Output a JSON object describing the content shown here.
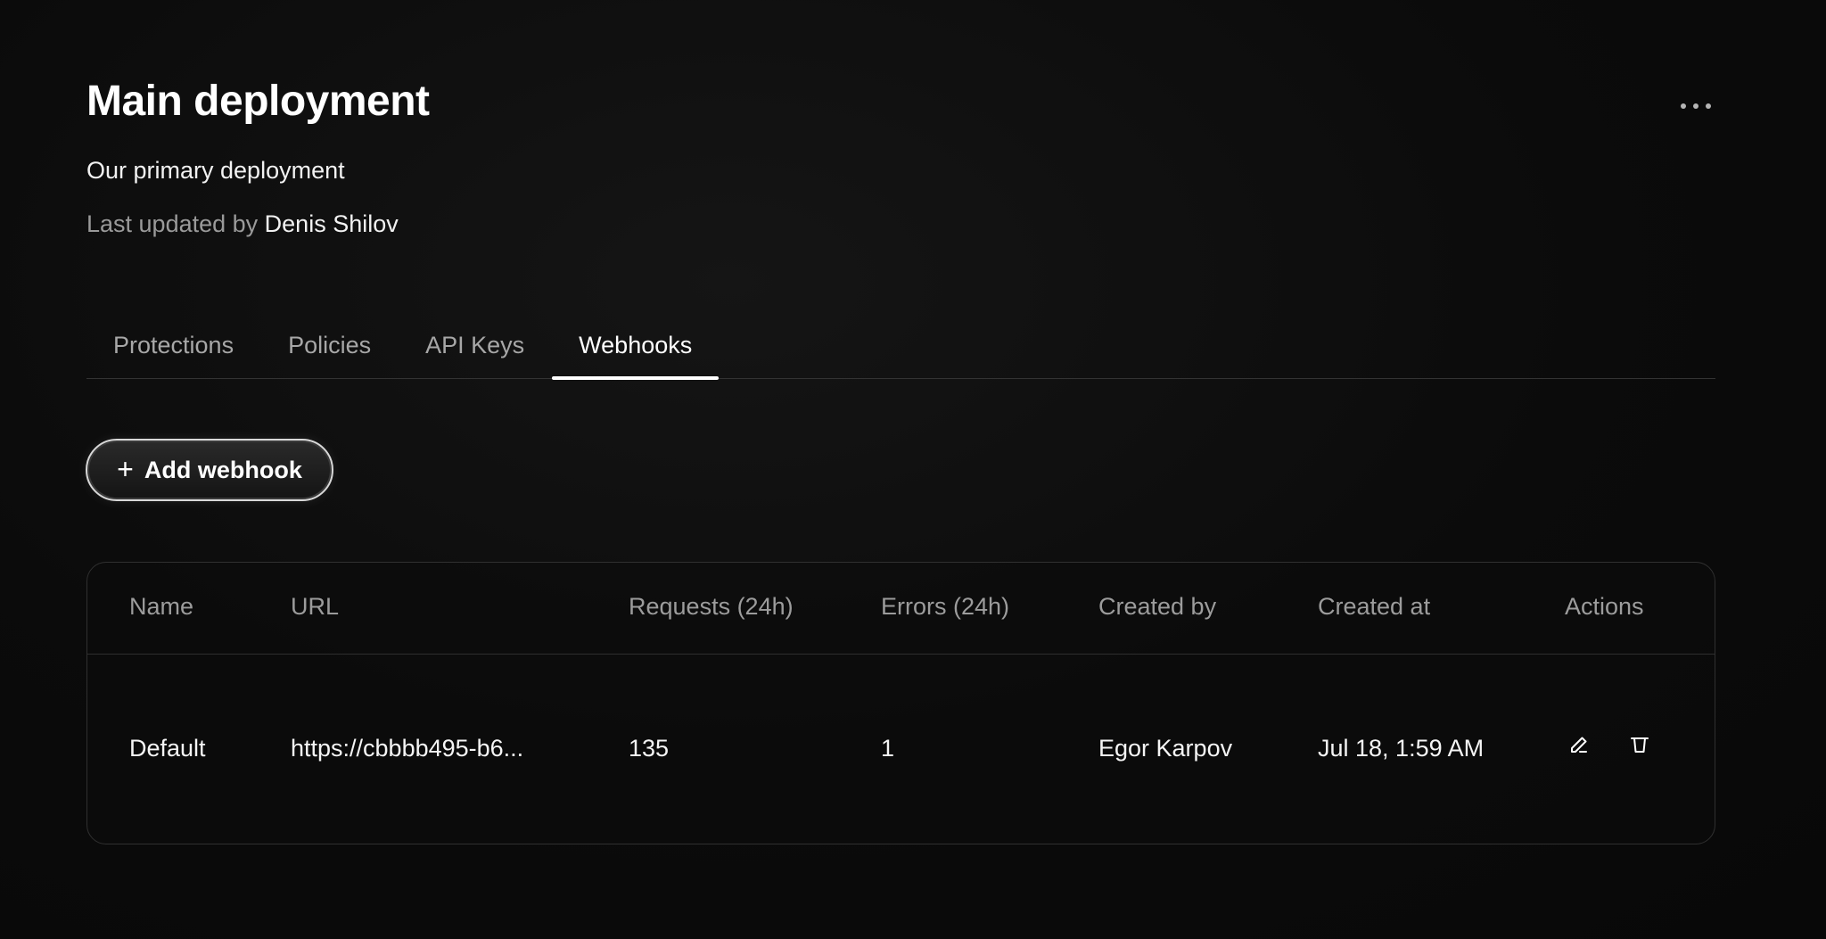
{
  "header": {
    "title": "Main deployment",
    "description": "Our primary deployment",
    "updated_prefix": "Last updated by",
    "updated_by": "Denis Shilov",
    "more_icon": "more-horizontal-icon"
  },
  "tabs": [
    {
      "label": "Protections",
      "active": false
    },
    {
      "label": "Policies",
      "active": false
    },
    {
      "label": "API Keys",
      "active": false
    },
    {
      "label": "Webhooks",
      "active": true
    }
  ],
  "add_button": {
    "icon": "plus-icon",
    "label": "Add webhook"
  },
  "table": {
    "columns": [
      "Name",
      "URL",
      "Requests (24h)",
      "Errors (24h)",
      "Created by",
      "Created at",
      "Actions"
    ],
    "rows": [
      {
        "name": "Default",
        "url": "https://cbbbb495-b6...",
        "requests": "135",
        "errors": "1",
        "created_by": "Egor Karpov",
        "created_at": "Jul 18, 1:59 AM",
        "actions": [
          "edit-icon",
          "trash-icon"
        ]
      }
    ]
  }
}
